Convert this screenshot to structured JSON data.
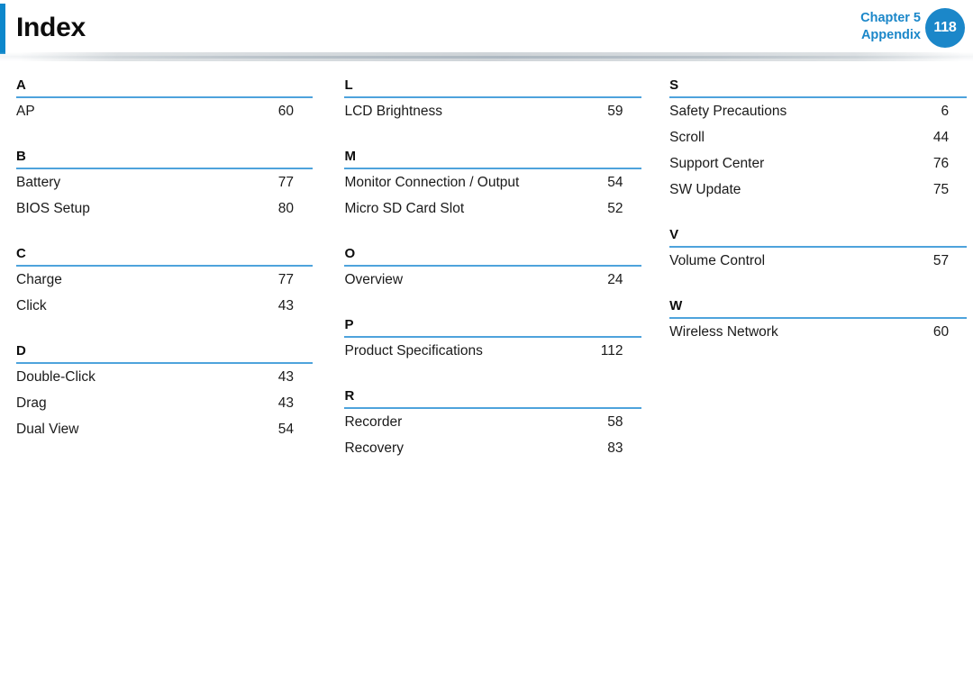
{
  "header": {
    "title": "Index",
    "chapter_label": "Chapter 5",
    "section_label": "Appendix",
    "page_number": "118",
    "accent_color": "#0d87cb",
    "badge_color": "#1b87c9",
    "rule_color": "#4ea3dc"
  },
  "columns": [
    {
      "sections": [
        {
          "letter": "A",
          "entries": [
            {
              "title": "AP",
              "page": "60"
            }
          ]
        },
        {
          "letter": "B",
          "entries": [
            {
              "title": "Battery",
              "page": "77"
            },
            {
              "title": "BIOS Setup",
              "page": "80"
            }
          ]
        },
        {
          "letter": "C",
          "entries": [
            {
              "title": "Charge",
              "page": "77"
            },
            {
              "title": "Click",
              "page": "43"
            }
          ]
        },
        {
          "letter": "D",
          "entries": [
            {
              "title": "Double-Click",
              "page": "43"
            },
            {
              "title": "Drag",
              "page": "43"
            },
            {
              "title": "Dual View",
              "page": "54"
            }
          ]
        }
      ]
    },
    {
      "sections": [
        {
          "letter": "L",
          "entries": [
            {
              "title": "LCD Brightness",
              "page": "59"
            }
          ]
        },
        {
          "letter": "M",
          "entries": [
            {
              "title": "Monitor Connection / Output",
              "page": "54"
            },
            {
              "title": "Micro SD Card Slot",
              "page": "52"
            }
          ]
        },
        {
          "letter": "O",
          "entries": [
            {
              "title": "Overview",
              "page": "24"
            }
          ]
        },
        {
          "letter": "P",
          "entries": [
            {
              "title": "Product Specifications",
              "page": "112"
            }
          ]
        },
        {
          "letter": "R",
          "entries": [
            {
              "title": "Recorder",
              "page": "58"
            },
            {
              "title": "Recovery",
              "page": "83"
            }
          ]
        }
      ]
    },
    {
      "sections": [
        {
          "letter": "S",
          "entries": [
            {
              "title": "Safety Precautions",
              "page": "6"
            },
            {
              "title": "Scroll",
              "page": "44"
            },
            {
              "title": "Support Center",
              "page": "76"
            },
            {
              "title": "SW Update",
              "page": "75"
            }
          ]
        },
        {
          "letter": "V",
          "entries": [
            {
              "title": "Volume Control",
              "page": "57"
            }
          ]
        },
        {
          "letter": "W",
          "entries": [
            {
              "title": "Wireless Network",
              "page": "60"
            }
          ]
        }
      ]
    }
  ]
}
